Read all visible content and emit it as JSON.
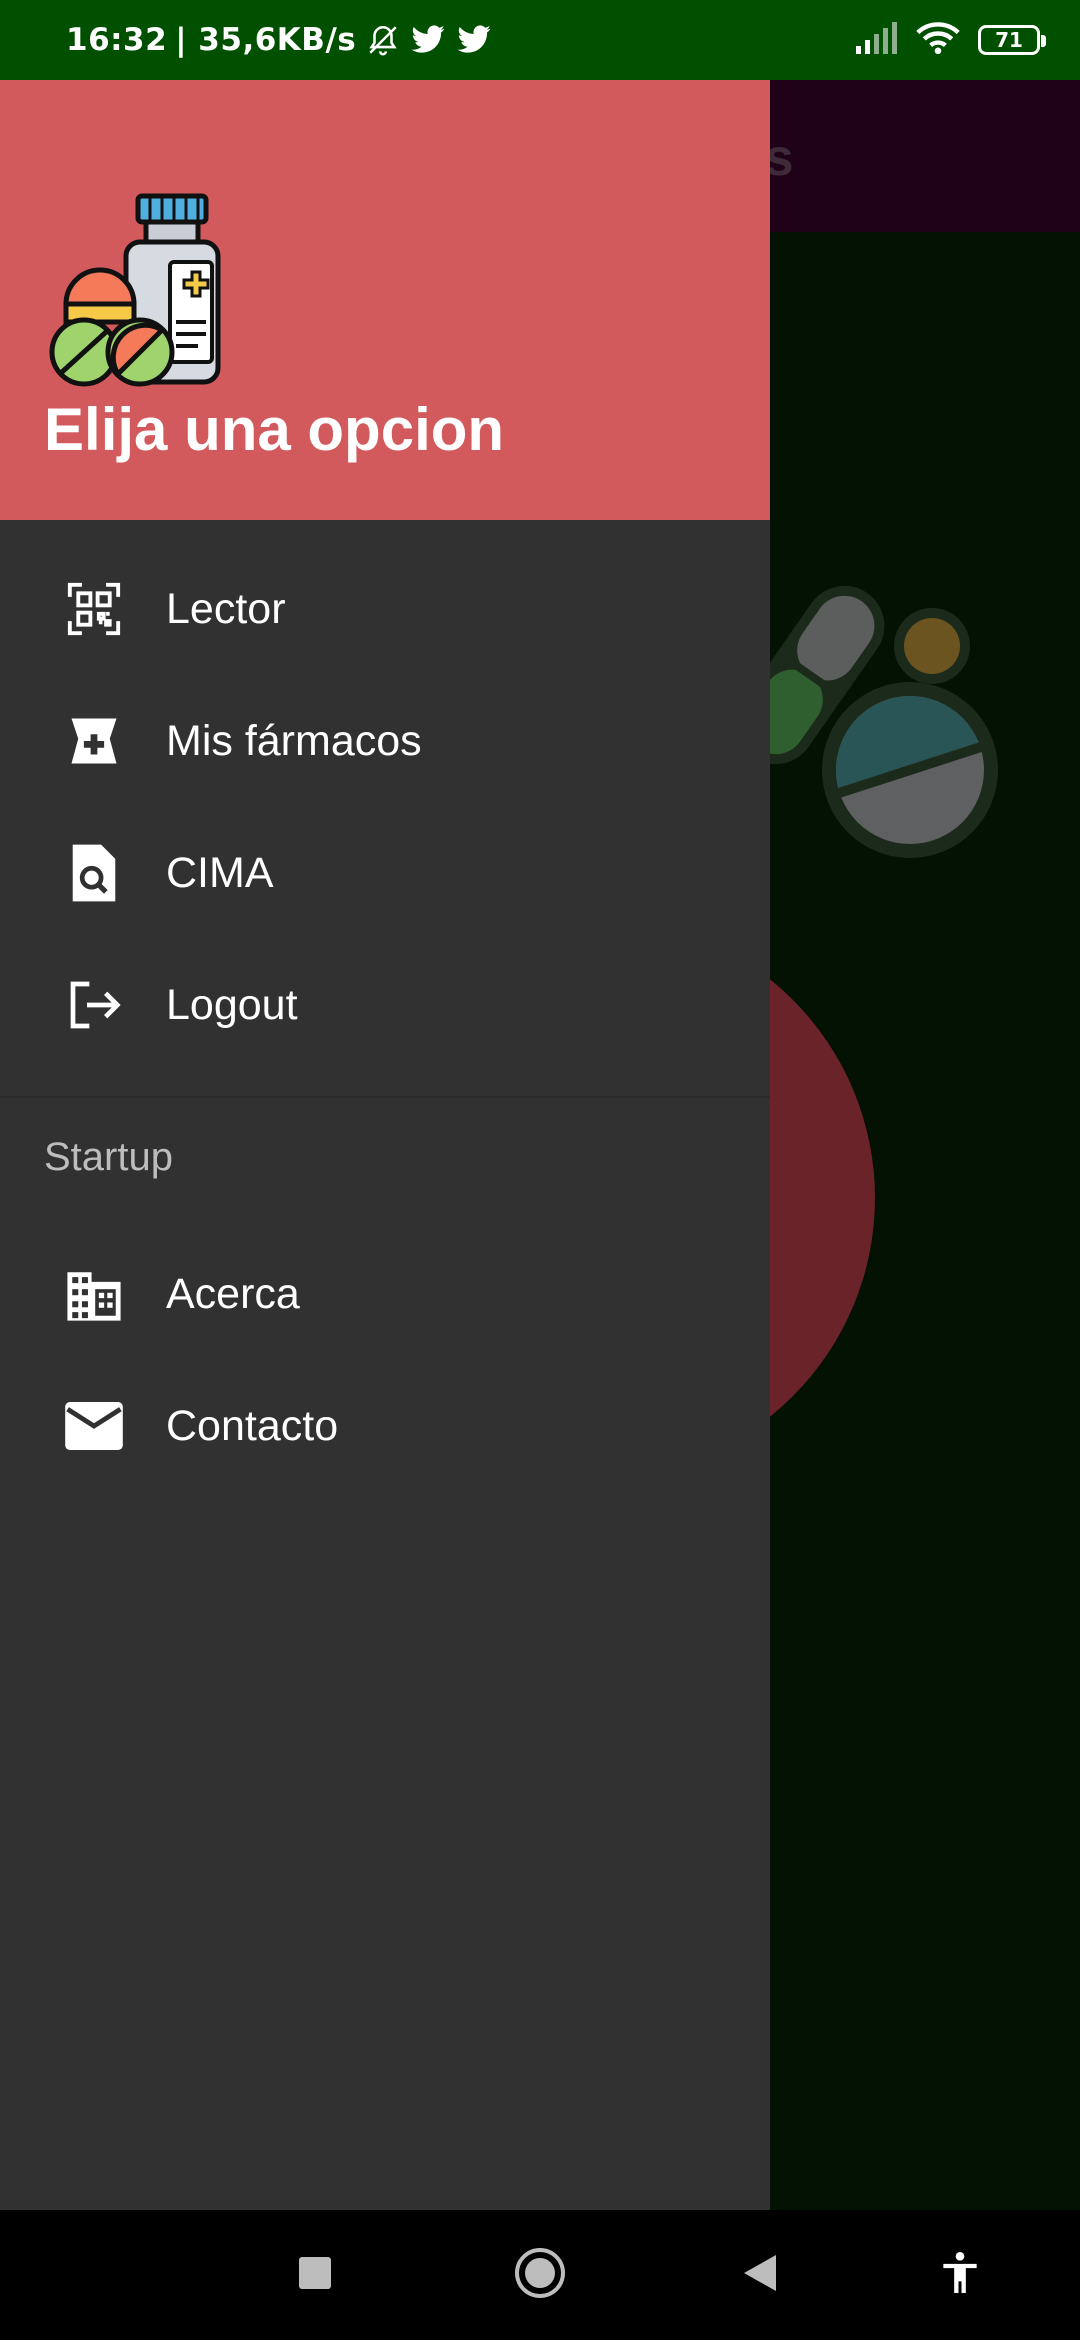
{
  "status_bar": {
    "time": "16:32",
    "network_speed": "| 35,6KB/s",
    "battery_level": "71",
    "icons": [
      "muted-bell-icon",
      "twitter-icon",
      "twitter-icon",
      "signal-icon",
      "wifi-icon",
      "battery-icon"
    ]
  },
  "background_app": {
    "title_fragment": "cos"
  },
  "drawer": {
    "header_title": "Elija una opcion",
    "header_color": "#d35a5c",
    "items": [
      {
        "label": "Lector",
        "icon": "qr-scanner-icon"
      },
      {
        "label": "Mis fármacos",
        "icon": "medicine-icon"
      },
      {
        "label": "CIMA",
        "icon": "file-search-icon"
      },
      {
        "label": "Logout",
        "icon": "logout-icon"
      }
    ],
    "section_title": "Startup",
    "section_items": [
      {
        "label": "Acerca",
        "icon": "building-icon"
      },
      {
        "label": "Contacto",
        "icon": "mail-icon"
      }
    ]
  },
  "nav_bar": {
    "buttons": [
      "recents-icon",
      "home-icon",
      "back-icon",
      "accessibility-icon"
    ]
  }
}
